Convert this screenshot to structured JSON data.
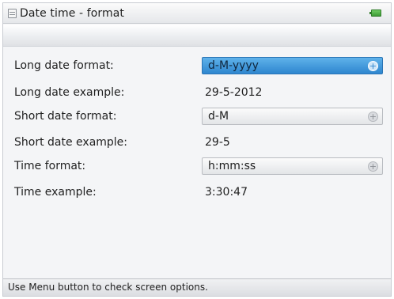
{
  "window": {
    "title": "Date  time - format",
    "title_icon": "document-icon",
    "status_icon": "battery-icon"
  },
  "form": {
    "long_date_format": {
      "label": "Long date format:",
      "value": "d-M-yyyy",
      "icon": "plus-icon"
    },
    "long_date_example": {
      "label": "Long date example:",
      "value": "29-5-2012"
    },
    "short_date_format": {
      "label": "Short date format:",
      "value": "d-M",
      "icon": "plus-icon"
    },
    "short_date_example": {
      "label": "Short date example:",
      "value": "29-5"
    },
    "time_format": {
      "label": "Time format:",
      "value": "h:mm:ss",
      "icon": "plus-icon"
    },
    "time_example": {
      "label": "Time example:",
      "value": "3:30:47"
    }
  },
  "status": {
    "message": "Use Menu button to check screen options."
  },
  "colors": {
    "selected_field": "#2e86cf",
    "battery": "#4aaa3f"
  }
}
